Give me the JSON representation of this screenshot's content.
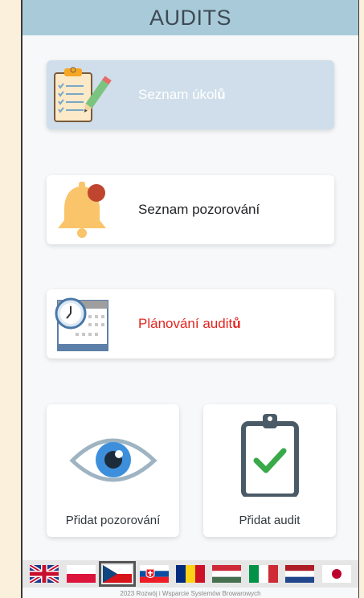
{
  "header": {
    "title": "AUDITS"
  },
  "menu": {
    "task_list": {
      "label": "Seznam úkol",
      "label_bold": "ů"
    },
    "observations": {
      "label": "Seznam pozorování"
    },
    "audit_planning": {
      "label": "Plánování audit",
      "label_bold": "ů"
    }
  },
  "actions": {
    "add_observation": {
      "label": "Přidat pozorování"
    },
    "add_audit": {
      "label": "Přidat audit"
    }
  },
  "languages": [
    "gb-flag-icon",
    "pl-flag-icon",
    "cz-flag-icon",
    "sk-flag-icon",
    "ro-flag-icon",
    "hu-flag-icon",
    "it-flag-icon",
    "nl-flag-icon",
    "jp-flag-icon"
  ],
  "selected_language": "cz",
  "footer": {
    "text": "2023 Rozwój i Wsparcie Systemów Browarowych"
  },
  "colors": {
    "header_bg": "#a9cbd9",
    "active_card": "#cfdeea",
    "accent_red": "#e0251f"
  }
}
